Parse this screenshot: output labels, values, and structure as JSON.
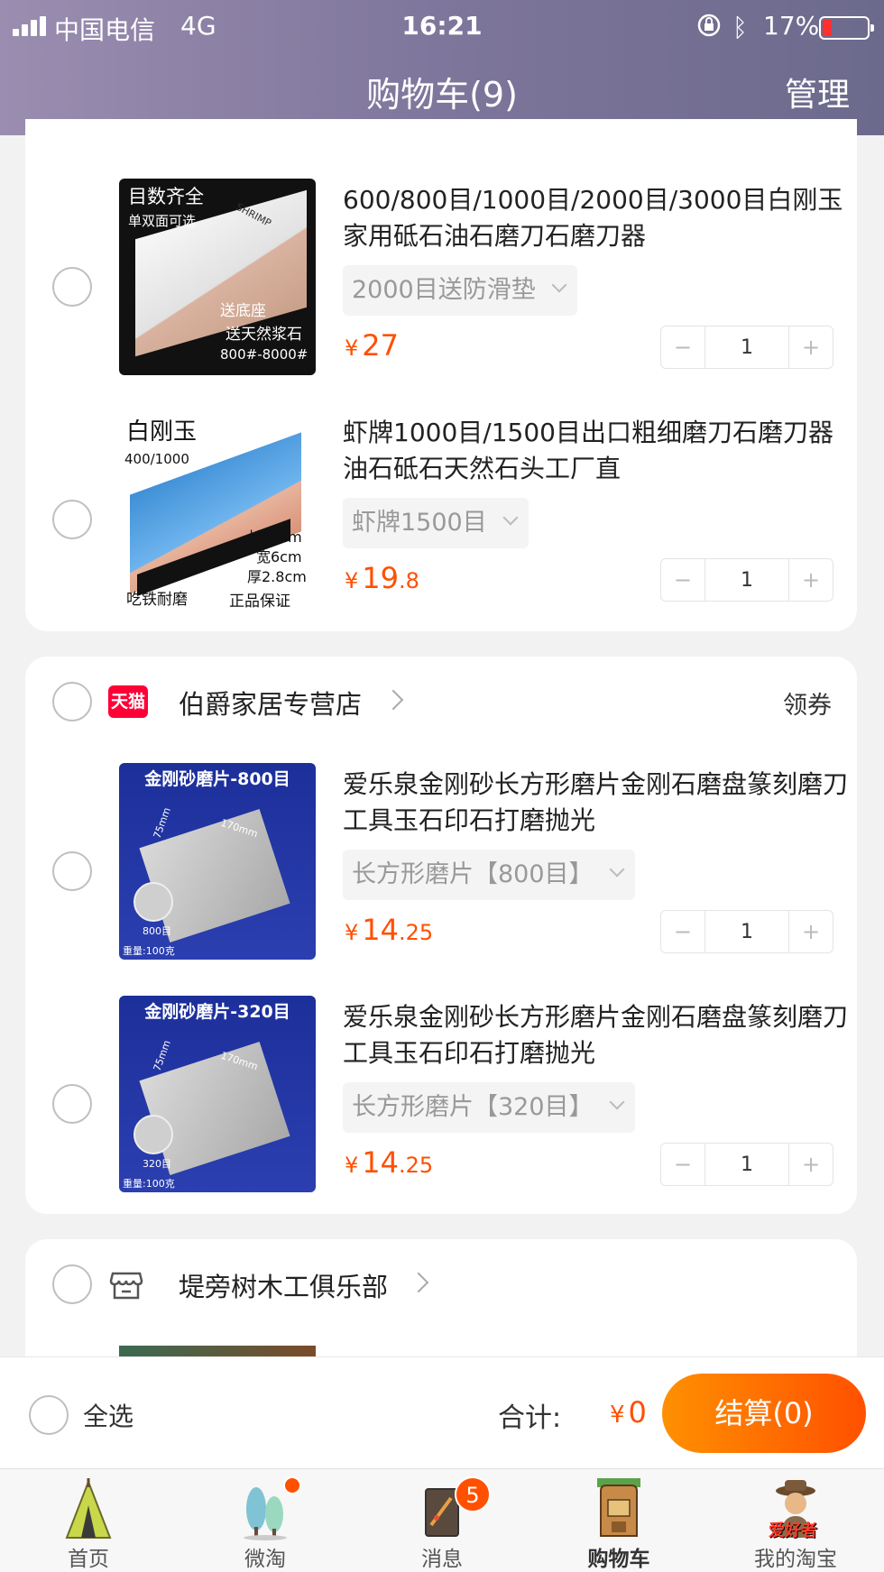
{
  "status": {
    "carrier": "中国电信",
    "network": "4G",
    "time": "16:21",
    "battery": "17%"
  },
  "header": {
    "title": "购物车(9)",
    "manage": "管理"
  },
  "items": [
    {
      "name": "600/800目/1000目/2000目/3000目白刚玉家用砥石油石磨刀石磨刀器",
      "sku": "2000目送防滑垫",
      "yen": "¥",
      "price_int": "27",
      "price_dec": "",
      "qty": "1",
      "thumb": {
        "t1": "目数齐全",
        "t2": "单双面可选",
        "t3": "送底座",
        "t4": "送天然浆石",
        "t5": "800#-8000#",
        "t6": "SHRIMP"
      }
    },
    {
      "name": "虾牌1000目/1500目出口粗细磨刀石磨刀器油石砥石天然石头工厂直",
      "sku": "虾牌1500目",
      "yen": "¥",
      "price_int": "19",
      "price_dec": ".8",
      "qty": "1",
      "thumb": {
        "t1": "白刚玉",
        "t2": "400/1000",
        "t3": "长18cm",
        "t4": "宽6cm",
        "t5": "厚2.8cm",
        "t6": "吃铁耐磨",
        "t7": "正品保证"
      }
    },
    {
      "name": "爱乐泉金刚砂长方形磨片金刚石磨盘篆刻磨刀工具玉石印石打磨抛光",
      "sku": "长方形磨片【800目】",
      "yen": "¥",
      "price_int": "14",
      "price_dec": ".25",
      "qty": "1",
      "thumb": {
        "band": "金刚砂磨片-800目",
        "w": "75mm",
        "l": "170mm",
        "grit": "800目",
        "weight": "重量:100克"
      }
    },
    {
      "name": "爱乐泉金刚砂长方形磨片金刚石磨盘篆刻磨刀工具玉石印石打磨抛光",
      "sku": "长方形磨片【320目】",
      "yen": "¥",
      "price_int": "14",
      "price_dec": ".25",
      "qty": "1",
      "thumb": {
        "band": "金刚砂磨片-320目",
        "w": "75mm",
        "l": "170mm",
        "grit": "320目",
        "weight": "重量:100克"
      }
    }
  ],
  "stepper": {
    "minus": "−",
    "plus": "+"
  },
  "shops": [
    {
      "name": "伯爵家居专营店",
      "coupon": "领券",
      "badge": "天猫"
    },
    {
      "name": "堤旁树木工俱乐部"
    }
  ],
  "checkout": {
    "select_all": "全选",
    "total_label": "合计:",
    "yen": "¥",
    "total_value": "0",
    "pay_button": "结算(0)"
  },
  "tabs": [
    {
      "label": "首页",
      "icon": "home-tent-icon"
    },
    {
      "label": "微淘",
      "icon": "trees-icon"
    },
    {
      "label": "消息",
      "icon": "message-icon",
      "badge": "5"
    },
    {
      "label": "购物车",
      "icon": "backpack-cart-icon"
    },
    {
      "label": "我的淘宝",
      "icon": "explorer-avatar-icon",
      "overlay": "爱好者"
    }
  ],
  "colors": {
    "accent": "#ff5000",
    "header_start": "#9a8db0",
    "header_end": "#6c6a8c",
    "tmall": "#ff0036"
  }
}
